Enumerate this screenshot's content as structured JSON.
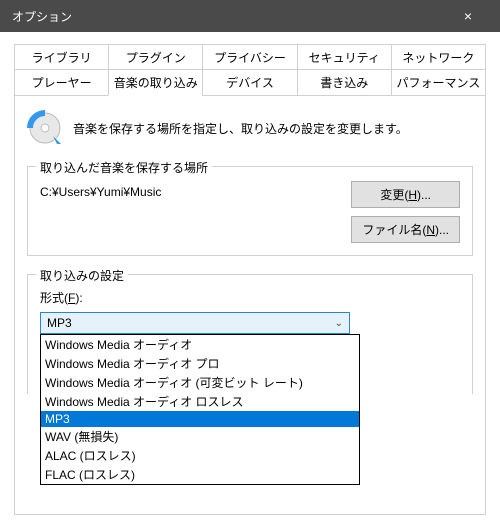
{
  "window": {
    "title": "オプション",
    "close": "×"
  },
  "tabs": {
    "row1": [
      "ライブラリ",
      "プラグイン",
      "プライバシー",
      "セキュリティ",
      "ネットワーク"
    ],
    "row2": [
      "プレーヤー",
      "音楽の取り込み",
      "デバイス",
      "書き込み",
      "パフォーマンス"
    ],
    "active": "音楽の取り込み"
  },
  "intro": "音楽を保存する場所を指定し、取り込みの設定を変更します。",
  "storage": {
    "group_title": "取り込んだ音楽を保存する場所",
    "path": "C:¥Users¥Yumi¥Music",
    "change_btn": {
      "text": "変更(",
      "ul": "H",
      "suffix": ")..."
    },
    "filename_btn": {
      "text": "ファイル名(",
      "ul": "N",
      "suffix": ")..."
    }
  },
  "settings": {
    "group_title": "取り込みの設定",
    "format_label": {
      "text": "形式(",
      "ul": "F",
      "suffix": "):"
    },
    "selected": "MP3",
    "options": [
      "Windows Media オーディオ",
      "Windows Media オーディオ プロ",
      "Windows Media オーディオ (可変ビット レート)",
      "Windows Media オーディオ ロスレス",
      "MP3",
      "WAV (無損失)",
      "ALAC (ロスレス)",
      "FLAC (ロスレス)"
    ]
  }
}
